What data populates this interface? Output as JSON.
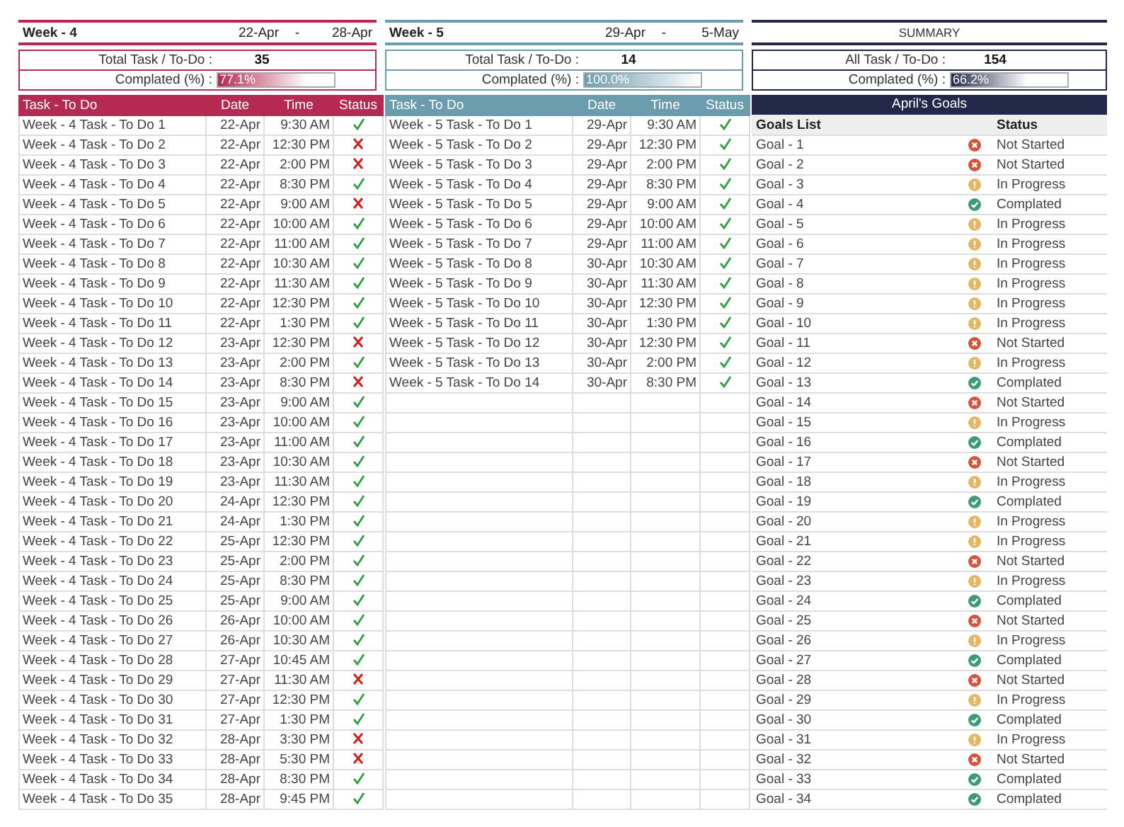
{
  "weeks": [
    {
      "title": "Week - 4",
      "start": "22-Apr",
      "separator": "-",
      "end": "28-Apr",
      "total_label": "Total Task / To-Do :",
      "total": "35",
      "completed_label": "Complated (%) :",
      "completed": "77.1%",
      "level": 0.771,
      "color": "#b42a52",
      "columns": [
        "Task - To Do",
        "Date",
        "Time",
        "Status"
      ],
      "tasks": [
        {
          "name": "Week - 4 Task - To Do 1",
          "date": "22-Apr",
          "time": "9:30 AM",
          "done": true
        },
        {
          "name": "Week - 4 Task - To Do 2",
          "date": "22-Apr",
          "time": "12:30 PM",
          "done": false
        },
        {
          "name": "Week - 4 Task - To Do 3",
          "date": "22-Apr",
          "time": "2:00 PM",
          "done": false
        },
        {
          "name": "Week - 4 Task - To Do 4",
          "date": "22-Apr",
          "time": "8:30 PM",
          "done": true
        },
        {
          "name": "Week - 4 Task - To Do 5",
          "date": "22-Apr",
          "time": "9:00 AM",
          "done": false
        },
        {
          "name": "Week - 4 Task - To Do 6",
          "date": "22-Apr",
          "time": "10:00 AM",
          "done": true
        },
        {
          "name": "Week - 4 Task - To Do 7",
          "date": "22-Apr",
          "time": "11:00 AM",
          "done": true
        },
        {
          "name": "Week - 4 Task - To Do 8",
          "date": "22-Apr",
          "time": "10:30 AM",
          "done": true
        },
        {
          "name": "Week - 4 Task - To Do 9",
          "date": "22-Apr",
          "time": "11:30 AM",
          "done": true
        },
        {
          "name": "Week - 4 Task - To Do 10",
          "date": "22-Apr",
          "time": "12:30 PM",
          "done": true
        },
        {
          "name": "Week - 4 Task - To Do 11",
          "date": "22-Apr",
          "time": "1:30 PM",
          "done": true
        },
        {
          "name": "Week - 4 Task - To Do 12",
          "date": "23-Apr",
          "time": "12:30 PM",
          "done": false
        },
        {
          "name": "Week - 4 Task - To Do 13",
          "date": "23-Apr",
          "time": "2:00 PM",
          "done": true
        },
        {
          "name": "Week - 4 Task - To Do 14",
          "date": "23-Apr",
          "time": "8:30 PM",
          "done": false
        },
        {
          "name": "Week - 4 Task - To Do 15",
          "date": "23-Apr",
          "time": "9:00 AM",
          "done": true
        },
        {
          "name": "Week - 4 Task - To Do 16",
          "date": "23-Apr",
          "time": "10:00 AM",
          "done": true
        },
        {
          "name": "Week - 4 Task - To Do 17",
          "date": "23-Apr",
          "time": "11:00 AM",
          "done": true
        },
        {
          "name": "Week - 4 Task - To Do 18",
          "date": "23-Apr",
          "time": "10:30 AM",
          "done": true
        },
        {
          "name": "Week - 4 Task - To Do 19",
          "date": "23-Apr",
          "time": "11:30 AM",
          "done": true
        },
        {
          "name": "Week - 4 Task - To Do 20",
          "date": "24-Apr",
          "time": "12:30 PM",
          "done": true
        },
        {
          "name": "Week - 4 Task - To Do 21",
          "date": "24-Apr",
          "time": "1:30 PM",
          "done": true
        },
        {
          "name": "Week - 4 Task - To Do 22",
          "date": "25-Apr",
          "time": "12:30 PM",
          "done": true
        },
        {
          "name": "Week - 4 Task - To Do 23",
          "date": "25-Apr",
          "time": "2:00 PM",
          "done": true
        },
        {
          "name": "Week - 4 Task - To Do 24",
          "date": "25-Apr",
          "time": "8:30 PM",
          "done": true
        },
        {
          "name": "Week - 4 Task - To Do 25",
          "date": "25-Apr",
          "time": "9:00 AM",
          "done": true
        },
        {
          "name": "Week - 4 Task - To Do 26",
          "date": "26-Apr",
          "time": "10:00 AM",
          "done": true
        },
        {
          "name": "Week - 4 Task - To Do 27",
          "date": "26-Apr",
          "time": "10:30 AM",
          "done": true
        },
        {
          "name": "Week - 4 Task - To Do 28",
          "date": "27-Apr",
          "time": "10:45 AM",
          "done": true
        },
        {
          "name": "Week - 4 Task - To Do 29",
          "date": "27-Apr",
          "time": "11:30 AM",
          "done": false
        },
        {
          "name": "Week - 4 Task - To Do 30",
          "date": "27-Apr",
          "time": "12:30 PM",
          "done": true
        },
        {
          "name": "Week - 4 Task - To Do 31",
          "date": "27-Apr",
          "time": "1:30 PM",
          "done": true
        },
        {
          "name": "Week - 4 Task - To Do 32",
          "date": "28-Apr",
          "time": "3:30 PM",
          "done": false
        },
        {
          "name": "Week - 4 Task - To Do 33",
          "date": "28-Apr",
          "time": "5:30 PM",
          "done": false
        },
        {
          "name": "Week - 4 Task - To Do 34",
          "date": "28-Apr",
          "time": "8:30 PM",
          "done": true
        },
        {
          "name": "Week - 4 Task - To Do 35",
          "date": "28-Apr",
          "time": "9:45 PM",
          "done": true
        }
      ]
    },
    {
      "title": "Week - 5",
      "start": "29-Apr",
      "separator": "-",
      "end": "5-May",
      "total_label": "Total Task / To-Do :",
      "total": "14",
      "completed_label": "Complated (%) :",
      "completed": "100.0%",
      "level": 1.0,
      "color": "#6a9cae",
      "columns": [
        "Task - To Do",
        "Date",
        "Time",
        "Status"
      ],
      "tasks": [
        {
          "name": "Week - 5 Task - To Do 1",
          "date": "29-Apr",
          "time": "9:30 AM",
          "done": true
        },
        {
          "name": "Week - 5 Task - To Do 2",
          "date": "29-Apr",
          "time": "12:30 PM",
          "done": true
        },
        {
          "name": "Week - 5 Task - To Do 3",
          "date": "29-Apr",
          "time": "2:00 PM",
          "done": true
        },
        {
          "name": "Week - 5 Task - To Do 4",
          "date": "29-Apr",
          "time": "8:30 PM",
          "done": true
        },
        {
          "name": "Week - 5 Task - To Do 5",
          "date": "29-Apr",
          "time": "9:00 AM",
          "done": true
        },
        {
          "name": "Week - 5 Task - To Do 6",
          "date": "29-Apr",
          "time": "10:00 AM",
          "done": true
        },
        {
          "name": "Week - 5 Task - To Do 7",
          "date": "29-Apr",
          "time": "11:00 AM",
          "done": true
        },
        {
          "name": "Week - 5 Task - To Do 8",
          "date": "30-Apr",
          "time": "10:30 AM",
          "done": true
        },
        {
          "name": "Week - 5 Task - To Do 9",
          "date": "30-Apr",
          "time": "11:30 AM",
          "done": true
        },
        {
          "name": "Week - 5 Task - To Do 10",
          "date": "30-Apr",
          "time": "12:30 PM",
          "done": true
        },
        {
          "name": "Week - 5 Task - To Do 11",
          "date": "30-Apr",
          "time": "1:30 PM",
          "done": true
        },
        {
          "name": "Week - 5 Task - To Do 12",
          "date": "30-Apr",
          "time": "12:30 PM",
          "done": true
        },
        {
          "name": "Week - 5 Task - To Do 13",
          "date": "30-Apr",
          "time": "2:00 PM",
          "done": true
        },
        {
          "name": "Week - 5 Task - To Do 14",
          "date": "30-Apr",
          "time": "8:30 PM",
          "done": true
        }
      ]
    }
  ],
  "summary": {
    "title": "SUMMARY",
    "total_label": "All Task / To-Do :",
    "total": "154",
    "completed_label": "Complated (%) :",
    "completed": "66.2%",
    "level": 0.662,
    "goals_title": "April's Goals",
    "columns": [
      "Goals List",
      "Status"
    ],
    "goals": [
      {
        "name": "Goal - 1",
        "status": "Not Started",
        "kind": "not_started"
      },
      {
        "name": "Goal - 2",
        "status": "Not Started",
        "kind": "not_started"
      },
      {
        "name": "Goal - 3",
        "status": "In Progress",
        "kind": "in_progress"
      },
      {
        "name": "Goal - 4",
        "status": "Complated",
        "kind": "completed"
      },
      {
        "name": "Goal - 5",
        "status": "In Progress",
        "kind": "in_progress"
      },
      {
        "name": "Goal - 6",
        "status": "In Progress",
        "kind": "in_progress"
      },
      {
        "name": "Goal - 7",
        "status": "In Progress",
        "kind": "in_progress"
      },
      {
        "name": "Goal - 8",
        "status": "In Progress",
        "kind": "in_progress"
      },
      {
        "name": "Goal - 9",
        "status": "In Progress",
        "kind": "in_progress"
      },
      {
        "name": "Goal - 10",
        "status": "In Progress",
        "kind": "in_progress"
      },
      {
        "name": "Goal - 11",
        "status": "Not Started",
        "kind": "not_started"
      },
      {
        "name": "Goal - 12",
        "status": "In Progress",
        "kind": "in_progress"
      },
      {
        "name": "Goal - 13",
        "status": "Complated",
        "kind": "completed"
      },
      {
        "name": "Goal - 14",
        "status": "Not Started",
        "kind": "not_started"
      },
      {
        "name": "Goal - 15",
        "status": "In Progress",
        "kind": "in_progress"
      },
      {
        "name": "Goal - 16",
        "status": "Complated",
        "kind": "completed"
      },
      {
        "name": "Goal - 17",
        "status": "Not Started",
        "kind": "not_started"
      },
      {
        "name": "Goal - 18",
        "status": "In Progress",
        "kind": "in_progress"
      },
      {
        "name": "Goal - 19",
        "status": "Complated",
        "kind": "completed"
      },
      {
        "name": "Goal - 20",
        "status": "In Progress",
        "kind": "in_progress"
      },
      {
        "name": "Goal - 21",
        "status": "In Progress",
        "kind": "in_progress"
      },
      {
        "name": "Goal - 22",
        "status": "Not Started",
        "kind": "not_started"
      },
      {
        "name": "Goal - 23",
        "status": "In Progress",
        "kind": "in_progress"
      },
      {
        "name": "Goal - 24",
        "status": "Complated",
        "kind": "completed"
      },
      {
        "name": "Goal - 25",
        "status": "Not Started",
        "kind": "not_started"
      },
      {
        "name": "Goal - 26",
        "status": "In Progress",
        "kind": "in_progress"
      },
      {
        "name": "Goal - 27",
        "status": "Complated",
        "kind": "completed"
      },
      {
        "name": "Goal - 28",
        "status": "Not Started",
        "kind": "not_started"
      },
      {
        "name": "Goal - 29",
        "status": "In Progress",
        "kind": "in_progress"
      },
      {
        "name": "Goal - 30",
        "status": "Complated",
        "kind": "completed"
      },
      {
        "name": "Goal - 31",
        "status": "In Progress",
        "kind": "in_progress"
      },
      {
        "name": "Goal - 32",
        "status": "Not Started",
        "kind": "not_started"
      },
      {
        "name": "Goal - 33",
        "status": "Complated",
        "kind": "completed"
      },
      {
        "name": "Goal - 34",
        "status": "Complated",
        "kind": "completed"
      }
    ]
  }
}
